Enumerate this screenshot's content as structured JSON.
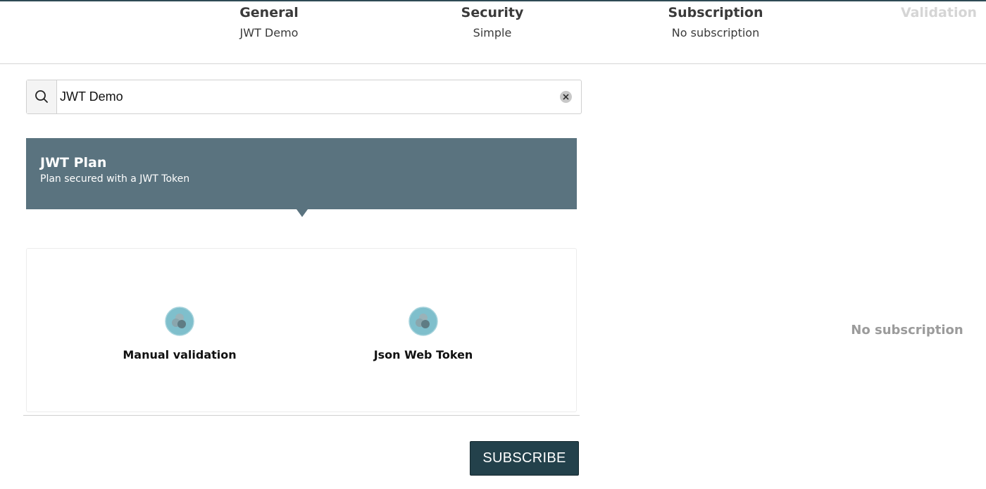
{
  "stepper": {
    "steps": [
      {
        "title": "General",
        "value": "JWT Demo"
      },
      {
        "title": "Security",
        "value": "Simple"
      },
      {
        "title": "Subscription",
        "value": "No subscription"
      },
      {
        "title": "Validation",
        "value": ""
      }
    ]
  },
  "search": {
    "value": "JWT Demo",
    "icon": "search-icon",
    "clear_icon": "clear-icon"
  },
  "plan": {
    "name": "JWT Plan",
    "description": "Plan secured with a JWT Token",
    "color": "#5a737f"
  },
  "security_types": [
    {
      "label": "Manual validation",
      "icon": "validation-type-icon"
    },
    {
      "label": "Json Web Token",
      "icon": "jwt-type-icon"
    }
  ],
  "actions": {
    "subscribe_label": "SUBSCRIBE",
    "color": "#23414b"
  },
  "summary": {
    "empty_text": "No subscription"
  }
}
